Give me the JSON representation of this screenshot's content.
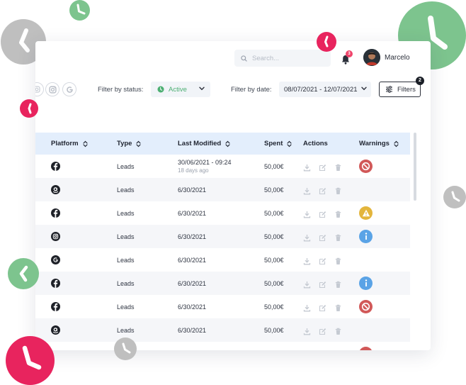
{
  "header": {
    "search_placeholder": "Search...",
    "notifications_count": "3",
    "user_name": "Marcelo"
  },
  "filters": {
    "platform_icons": [
      "instagram-icon",
      "google-icon"
    ],
    "status_label": "Filter by status:",
    "status_value": "Active",
    "date_label": "Filter by date:",
    "date_value": "08/07/2021 - 12/07/2021",
    "filters_button": "Filters",
    "filters_count": "2"
  },
  "table": {
    "headers": {
      "platform": "Platform",
      "type": "Type",
      "last_modified": "Last Modified",
      "spent": "Spent",
      "actions": "Actions",
      "warnings": "Warnings"
    },
    "rows": [
      {
        "platform": "facebook",
        "type": "Leads",
        "modified": "30/06/2021 - 09:24",
        "modified_sub": "18 days ago",
        "spent": "50,00€",
        "warning": "blocked"
      },
      {
        "platform": "amazon",
        "type": "Leads",
        "modified": "6/30/2021",
        "modified_sub": "",
        "spent": "50,00€",
        "warning": ""
      },
      {
        "platform": "facebook",
        "type": "Leads",
        "modified": "6/30/2021",
        "modified_sub": "",
        "spent": "50,00€",
        "warning": "alert"
      },
      {
        "platform": "instagram",
        "type": "Leads",
        "modified": "6/30/2021",
        "modified_sub": "",
        "spent": "50,00€",
        "warning": "info"
      },
      {
        "platform": "google",
        "type": "Leads",
        "modified": "6/30/2021",
        "modified_sub": "",
        "spent": "50,00€",
        "warning": ""
      },
      {
        "platform": "facebook",
        "type": "Leads",
        "modified": "6/30/2021",
        "modified_sub": "",
        "spent": "50,00€",
        "warning": "info"
      },
      {
        "platform": "facebook",
        "type": "Leads",
        "modified": "6/30/2021",
        "modified_sub": "",
        "spent": "50,00€",
        "warning": "blocked"
      },
      {
        "platform": "amazon",
        "type": "Leads",
        "modified": "6/30/2021",
        "modified_sub": "",
        "spent": "50,00€",
        "warning": ""
      }
    ]
  },
  "colors": {
    "accent_green": "#4caf72",
    "header_row": "#e3eefc",
    "warning_blocked": "#d15858",
    "warning_alert": "#e3b53c",
    "warning_info": "#5aa3e6",
    "badge_pink": "#f0446b",
    "clock_green": "#7dc48e",
    "clock_grey": "#bfbfbf",
    "clock_pink": "#e8245e"
  }
}
